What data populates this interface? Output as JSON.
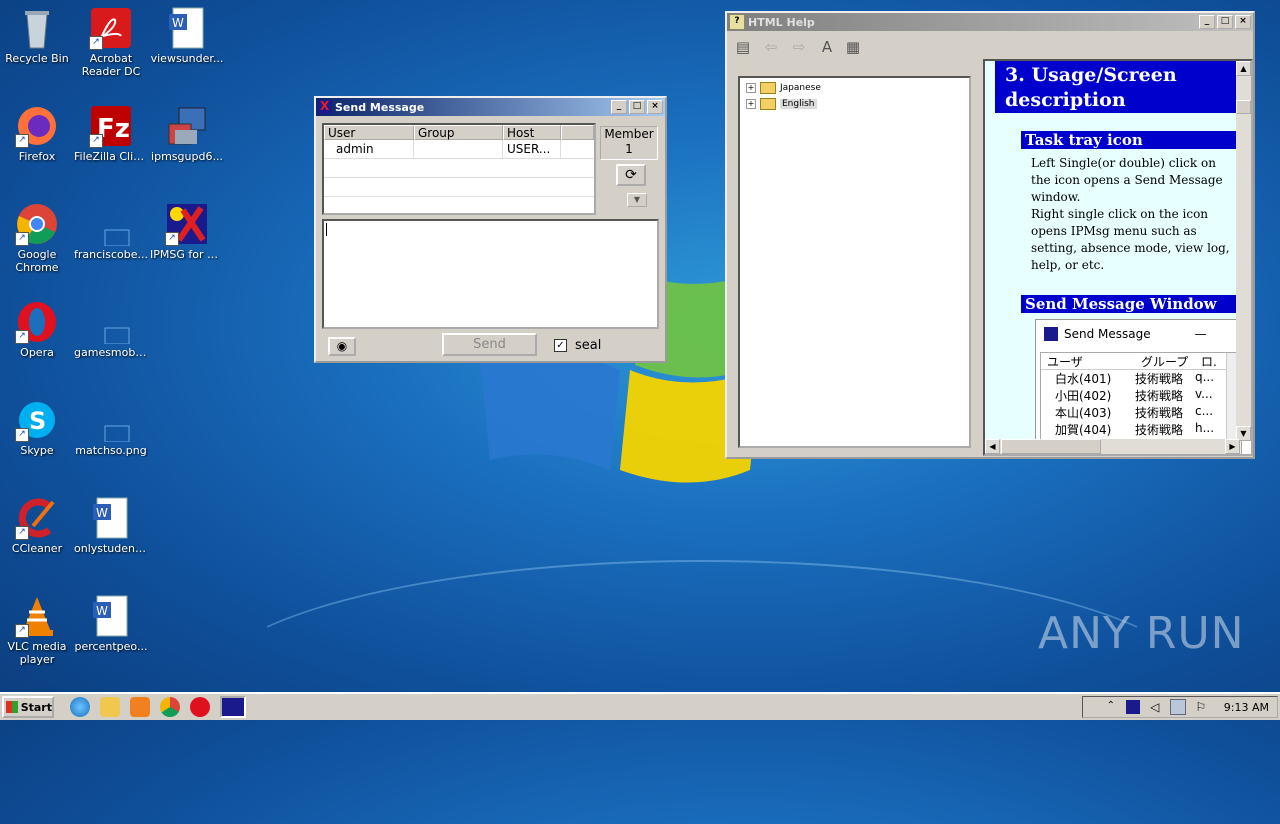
{
  "desktop": {
    "icons": [
      {
        "label": "Recycle Bin"
      },
      {
        "label": "Acrobat Reader DC"
      },
      {
        "label": "viewsunder..."
      },
      {
        "label": "Firefox"
      },
      {
        "label": "FileZilla Client"
      },
      {
        "label": "ipmsgupd6..."
      },
      {
        "label": "Google Chrome"
      },
      {
        "label": "franciscobe..."
      },
      {
        "label": "IPMSG for Win"
      },
      {
        "label": "Opera"
      },
      {
        "label": "gamesmobil..."
      },
      {
        "label": "Skype"
      },
      {
        "label": "matchso.png"
      },
      {
        "label": "CCleaner"
      },
      {
        "label": "onlystudent..."
      },
      {
        "label": "VLC media player"
      },
      {
        "label": "percentpeo..."
      }
    ],
    "watermark": "ANY RUN"
  },
  "send_message": {
    "title": "Send Message",
    "columns": [
      "User",
      "Group",
      "Host"
    ],
    "rows": [
      [
        "admin",
        "",
        "USER..."
      ]
    ],
    "member_label": "Member",
    "member_count": "1",
    "send_label": "Send",
    "seal_label": "seal",
    "seal_checked": true
  },
  "html_help": {
    "title": "HTML Help",
    "tree": [
      "Japanese",
      "English"
    ],
    "heading": "3. Usage/Screen description",
    "section1": "Task tray icon",
    "para1": "Left Single(or double) click on the icon opens a Send Message window.",
    "para2": "Right single click on the icon opens IPMsg menu such as setting, absence mode, view log, help, or etc.",
    "section2": "Send Message Window",
    "embedded": {
      "title": "Send Message",
      "columns": [
        "ユーザ",
        "グループ",
        "ロ."
      ],
      "rows": [
        [
          "白水(401)",
          "技術戦略",
          "q..."
        ],
        [
          "小田(402)",
          "技術戦略",
          "v..."
        ],
        [
          "本山(403)",
          "技術戦略",
          "c..."
        ],
        [
          "加賀(404)",
          "技術戦略",
          "h..."
        ]
      ]
    }
  },
  "taskbar": {
    "start_label": "Start",
    "clock": "9:13 AM"
  },
  "colors": {
    "title_active": "#0a246a",
    "help_heading_bg": "#0000cc",
    "help_bg": "#e8ffff"
  }
}
